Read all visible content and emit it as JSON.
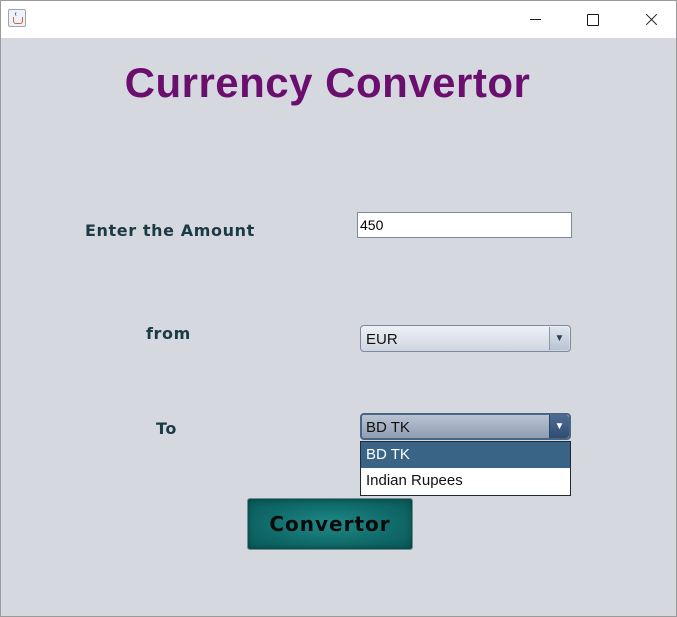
{
  "window": {
    "title": "",
    "icon": "java-cup-icon",
    "controls": {
      "minimize": "minimize-icon",
      "maximize": "maximize-icon",
      "close": "close-icon"
    }
  },
  "heading": "Currency Convertor",
  "form": {
    "amount_label": "Enter the Amount",
    "amount_value": "450",
    "from_label": "from",
    "from_selected": "EUR",
    "to_label": "To",
    "to_selected": "BD TK",
    "to_options": [
      "BD TK",
      "Indian Rupees"
    ],
    "to_highlighted_index": 0
  },
  "convert_button_label": "Convertor",
  "colors": {
    "heading": "#6b0f6e",
    "background": "#d6d8e0",
    "button": "#0f6968",
    "selection": "#3a6485"
  }
}
